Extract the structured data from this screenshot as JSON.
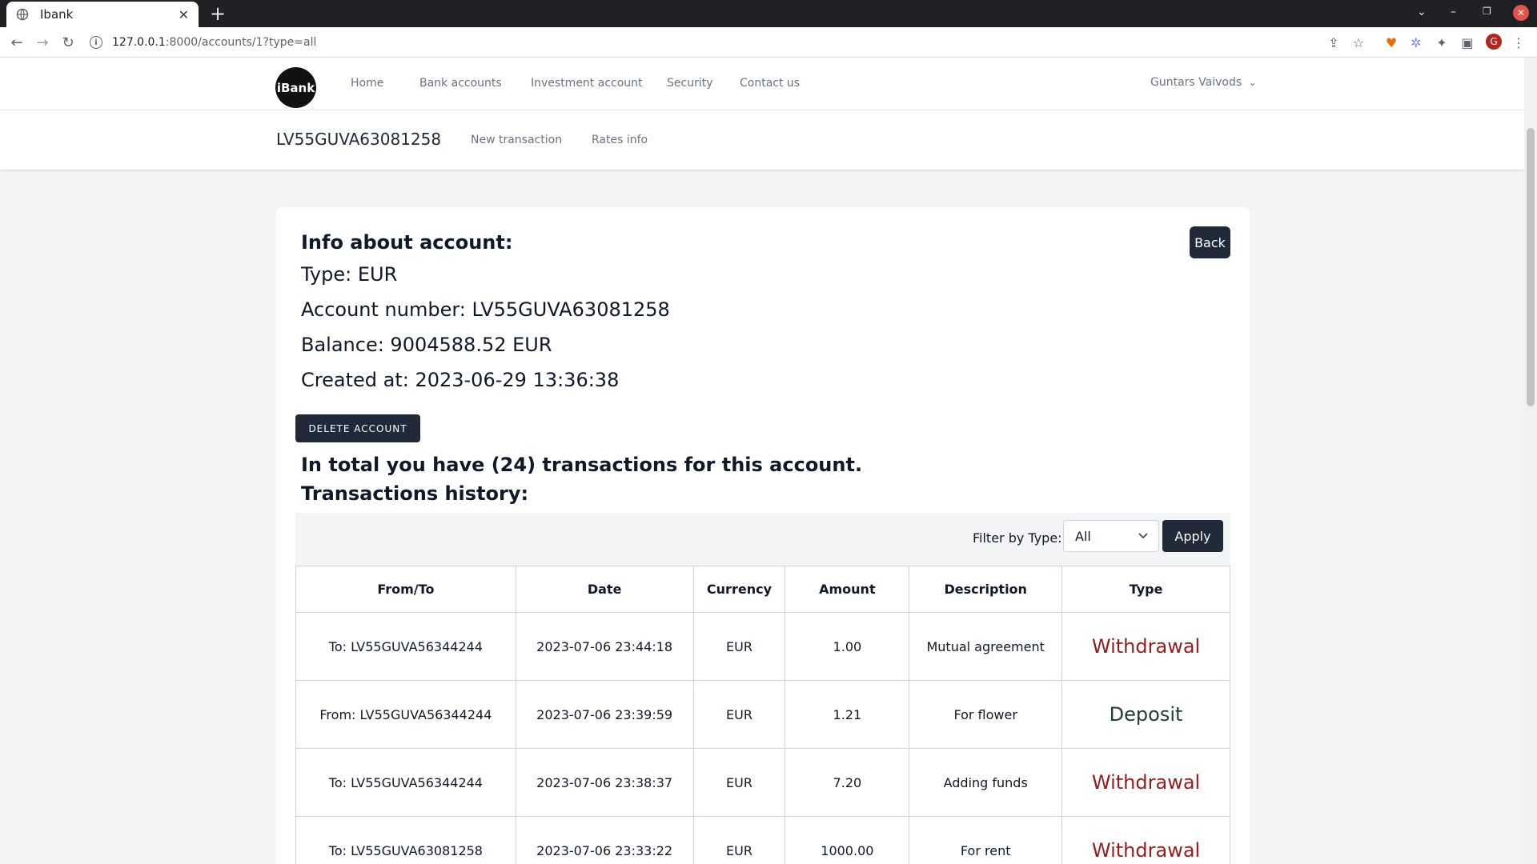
{
  "browser": {
    "tab_title": "Ibank",
    "url_host": "127.0.0.1",
    "url_path": ":8000/accounts/1?type=all",
    "profile_initial": "G"
  },
  "nav": {
    "logo": "iBank",
    "links": [
      "Home",
      "Bank accounts",
      "Investment account",
      "Security",
      "Contact us"
    ],
    "user": "Guntars Vaivods"
  },
  "subheader": {
    "account": "LV55GUVA63081258",
    "links": [
      "New transaction",
      "Rates info"
    ]
  },
  "info": {
    "title": "Info about account:",
    "type": "Type: EUR",
    "number": "Account number: LV55GUVA63081258",
    "balance": "Balance: 9004588.52 EUR",
    "created": "Created at: 2023-06-29 13:36:38",
    "back_label": "Back",
    "delete_label": "DELETE ACCOUNT"
  },
  "transactions": {
    "total_text": "In total you have (24) transactions for this account.",
    "history_title": "Transactions history:",
    "filter_label": "Filter by Type:",
    "filter_value": "All",
    "apply_label": "Apply",
    "columns": [
      "From/To",
      "Date",
      "Currency",
      "Amount",
      "Description",
      "Type"
    ],
    "rows": [
      {
        "party": "To: LV55GUVA56344244",
        "date": "2023-07-06 23:44:18",
        "currency": "EUR",
        "amount": "1.00",
        "description": "Mutual agreement",
        "type": "Withdrawal"
      },
      {
        "party": "From: LV55GUVA56344244",
        "date": "2023-07-06 23:39:59",
        "currency": "EUR",
        "amount": "1.21",
        "description": "For flower",
        "type": "Deposit"
      },
      {
        "party": "To: LV55GUVA56344244",
        "date": "2023-07-06 23:38:37",
        "currency": "EUR",
        "amount": "7.20",
        "description": "Adding funds",
        "type": "Withdrawal"
      },
      {
        "party": "To: LV55GUVA63081258",
        "date": "2023-07-06 23:33:22",
        "currency": "EUR",
        "amount": "1000.00",
        "description": "For rent",
        "type": "Withdrawal"
      }
    ]
  },
  "colors": {
    "withdrawal": "#991b1b",
    "deposit": "#1f4035",
    "dark_button": "#1f2937"
  }
}
